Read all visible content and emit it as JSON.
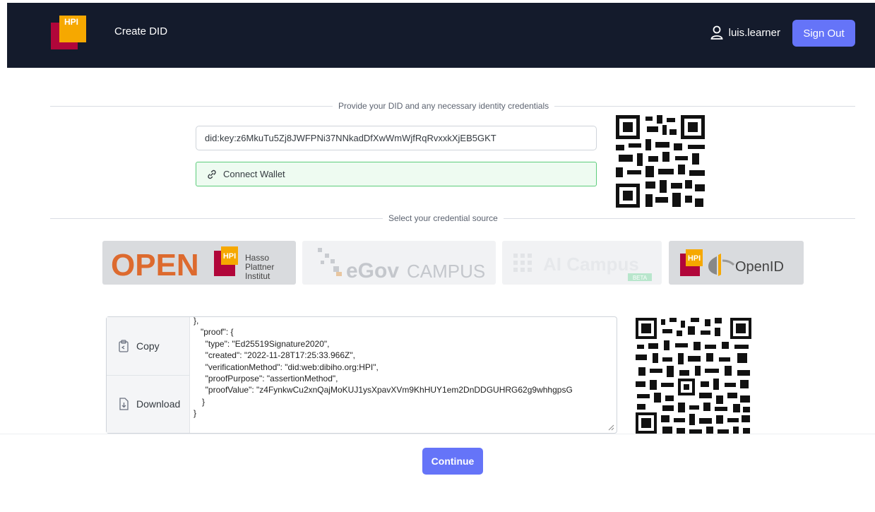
{
  "nav": {
    "logo_text": "HPI",
    "title": "Create DID",
    "username": "luis.learner",
    "signout_label": "Sign Out"
  },
  "did_section": {
    "label": "Provide your DID and any necessary identity credentials",
    "did_value": "did:key:z6MkuTu5Zj8JWFPNi37NNkadDfXwWmWjfRqRvxxkXjEB5GKT",
    "connect_label": "Connect Wallet"
  },
  "source_section": {
    "label": "Select your credential source",
    "sources": [
      {
        "name": "OPEN",
        "sub": "HPI",
        "sub2": "Hasso",
        "sub3": "Plattner",
        "sub4": "Institut"
      },
      {
        "name": "eGov",
        "sub": "CAMPUS"
      },
      {
        "name": "AI Campus",
        "sub": "BETA"
      },
      {
        "name": "OpenID",
        "sub": "HPI"
      }
    ]
  },
  "credential": {
    "copy_label": "Copy",
    "download_label": "Download",
    "lines": [
      "},",
      "\"proof\": {",
      "  \"type\": \"Ed25519Signature2020\",",
      "  \"created\": \"2022-11-28T17:25:33.966Z\",",
      "  \"verificationMethod\": \"did:web:dibiho.org:HPI\",",
      "  \"proofPurpose\": \"assertionMethod\",",
      "  \"proofValue\": \"z4FynkwCu2xnQajMoKUJ1ysXpavXVm9KhHUY1em2DnDDGUHRG62g9whhgpsG",
      "}",
      "}"
    ]
  },
  "footer": {
    "continue_label": "Continue"
  },
  "colors": {
    "navbar": "#141b2c",
    "accent": "#6574f8",
    "wallet_border": "#5ccc7b",
    "hpi_red": "#b1063a",
    "hpi_orange": "#f6a800"
  }
}
